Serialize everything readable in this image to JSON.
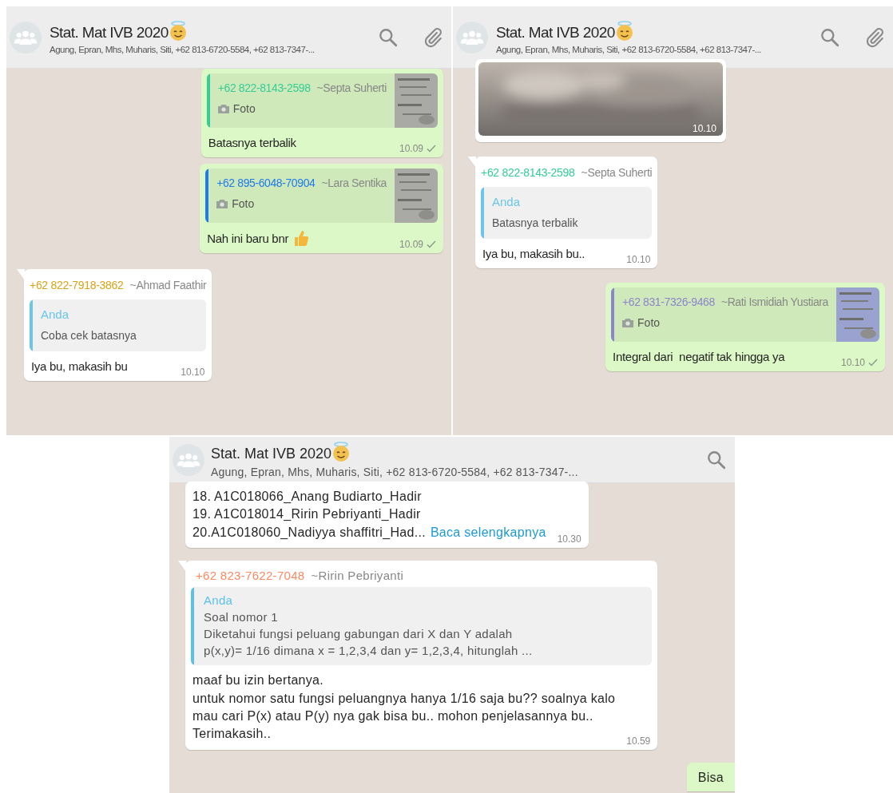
{
  "panels": [
    {
      "header": {
        "title": "Stat. Mat IVB 2020",
        "title_emoji": {
          "kind": "halo-smile"
        },
        "subtitle": "Agung, Epran, Mhs, Muharis, Siti, +62 813-6720-5584, +62 813-7347-...",
        "actions": [
          {
            "kind": "search"
          },
          {
            "kind": "attach"
          }
        ]
      },
      "messages": [
        {
          "kind": "outgoing",
          "quote": {
            "phone": "+62 822-8143-2598",
            "name": "~Septa Suherti",
            "color": "#35cd96",
            "caption": "Foto"
          },
          "text": "Batasnya terbalik",
          "time": "10.09",
          "ticked": true
        },
        {
          "kind": "outgoing",
          "quote": {
            "phone": "+62 895-6048-70904",
            "name": "~Lara Sentika",
            "color": "#1f7aec",
            "caption": "Foto"
          },
          "text": "Nah ini baru bnr",
          "emoji": {
            "kind": "thumbs-up"
          },
          "time": "10.09",
          "ticked": true
        },
        {
          "kind": "incoming",
          "tail": true,
          "sender": {
            "phone": "+62 822-7918-3862",
            "name": "~Ahmad Faathir",
            "color": "#d9a31a"
          },
          "quote": {
            "kind": "text",
            "author": "Anda",
            "color": "#6bc6e8",
            "lines": [
              "Coba cek batasnya"
            ]
          },
          "text": "Iya bu, makasih bu",
          "time": "10.10",
          "ticked": false
        }
      ]
    },
    {
      "header": {
        "title": "Stat. Mat IVB 2020",
        "title_emoji": {
          "kind": "halo-smile"
        },
        "subtitle": "Agung, Epran, Mhs, Muharis, Siti, +62 813-6720-5584, +62 813-7347-...",
        "actions": [
          {
            "kind": "search"
          },
          {
            "kind": "attach"
          }
        ]
      },
      "messages": [
        {
          "kind": "incoming",
          "time": "10.10"
        },
        {
          "kind": "incoming",
          "tail": true,
          "sender": {
            "phone": "+62 822-8143-2598",
            "name": "~Septa Suherti",
            "color": "#35cd96"
          },
          "quote": {
            "kind": "text",
            "author": "Anda",
            "color": "#6bc6e8",
            "lines": [
              "Batasnya terbalik"
            ]
          },
          "text": "Iya bu, makasih bu..",
          "time": "10.10",
          "ticked": false
        },
        {
          "kind": "outgoing",
          "quote": {
            "phone": "+62 831-7326-9468",
            "name": "~Rati Ismidiah Yustiara",
            "color": "#8c85cc",
            "caption": "Foto"
          },
          "text": "Integral dari  negatif tak hingga ya",
          "time": "10.10",
          "ticked": true
        }
      ]
    },
    {
      "header": {
        "title": "Stat. Mat IVB 2020",
        "title_emoji": {
          "kind": "halo-smile"
        },
        "subtitle": "Agung, Epran, Mhs, Muharis, Siti, +62 813-6720-5584, +62 813-7347-...",
        "actions": [
          {
            "kind": "search"
          }
        ]
      },
      "messages": [
        {
          "kind": "incoming",
          "tail": false,
          "text": "18. A1C018066_Anang Budiarto_Hadir\n19. A1C018014_Ririn Pebriyanti_Hadir\n20.A1C018060_Nadiyya shaffitri_Had...",
          "more_link": "Baca selengkapnya",
          "time": "10.30",
          "ticked": false
        },
        {
          "kind": "incoming",
          "tail": true,
          "sender": {
            "phone": "+62 823-7622-7048",
            "name": "~Ririn Pebriyanti",
            "color": "#fa8a60"
          },
          "quote": {
            "kind": "text",
            "author": "Anda",
            "color": "#5bc0eb",
            "lines": [
              "Soal nomor 1",
              "Diketahui fungsi peluang gabungan dari X dan Y adalah",
              "p(x,y)= 1/16 dimana x = 1,2,3,4 dan y= 1,2,3,4, hitunglah ..."
            ]
          },
          "text": "maaf bu izin bertanya.\nuntuk nomor satu fungsi peluangnya hanya 1/16 saja bu?? soalnya kalo\nmau cari P(x) atau P(y) nya gak bisa bu.. mohon penjelasannya bu..\nTerimakasih..",
          "time": "10.59",
          "ticked": false
        },
        {
          "kind": "outgoing",
          "text": "Bisa"
        }
      ]
    }
  ]
}
